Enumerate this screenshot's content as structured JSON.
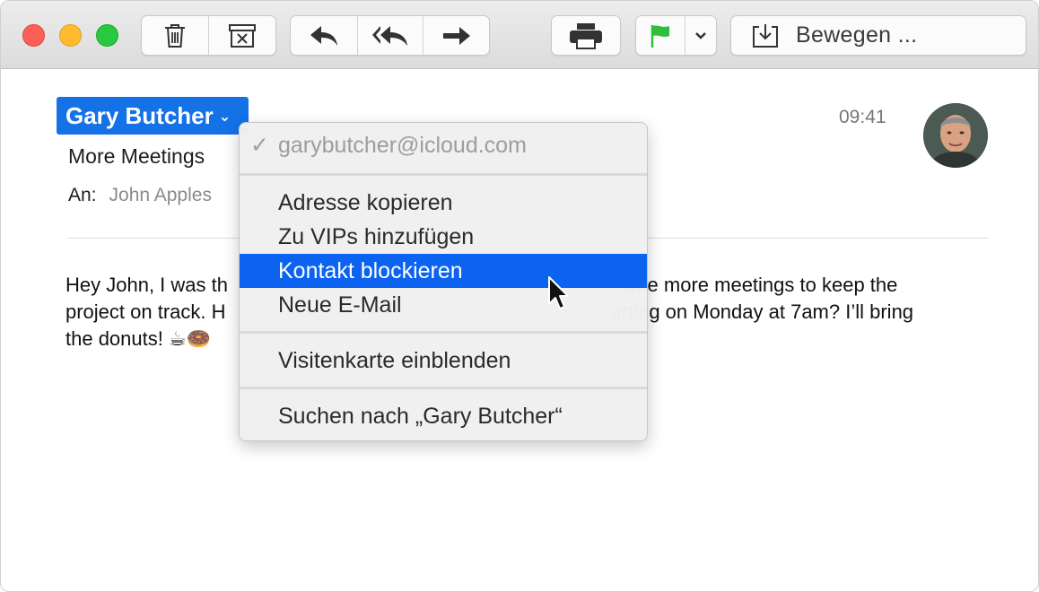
{
  "toolbar": {
    "buttons": [
      {
        "name": "trash-icon"
      },
      {
        "name": "archive-icon"
      },
      {
        "name": "reply-icon"
      },
      {
        "name": "reply-all-icon"
      },
      {
        "name": "forward-icon"
      },
      {
        "name": "print-icon"
      },
      {
        "name": "flag-icon"
      },
      {
        "name": "chevron-down-icon"
      }
    ],
    "move_label": "Bewegen ..."
  },
  "message": {
    "sender": "Gary Butcher",
    "time": "09:41",
    "subject": "More Meetings",
    "to_label": "An:",
    "to_value": "John Apples",
    "body_line1_start": "Hey John, I was th",
    "body_line1_end": "ome more meetings to keep the",
    "body_line2_start": "project on track. H",
    "body_line2_end": "arting on Monday at 7am? I’ll bring",
    "body_line3": "the donuts! ☕🍩"
  },
  "menu": {
    "email": "garybutcher@icloud.com",
    "check": "✓",
    "items": [
      "Adresse kopieren",
      "Zu VIPs hinzufügen",
      "Kontakt blockieren",
      "Neue E-Mail",
      "Visitenkarte einblenden",
      "Suchen nach „Gary Butcher“"
    ]
  },
  "colors": {
    "selection": "#0b63ef",
    "sender_chip": "#1472e6",
    "flag": "#2fbf3a"
  }
}
